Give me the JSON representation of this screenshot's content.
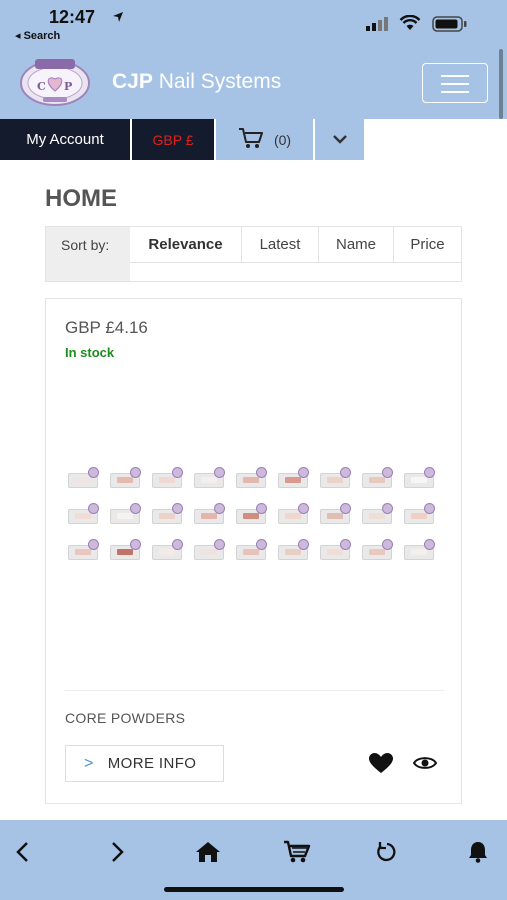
{
  "status_bar": {
    "time": "12:47",
    "back_label": "◂ Search"
  },
  "header": {
    "logo_text": "CJP",
    "brand_bold": "CJP",
    "brand_rest": " Nail Systems"
  },
  "account_bar": {
    "my_account": "My Account",
    "currency": "GBP £",
    "cart_count": "(0)"
  },
  "page": {
    "title": "HOME",
    "sort": {
      "label": "Sort by:",
      "options": [
        "Relevance",
        "Latest",
        "Name",
        "Price"
      ],
      "selected": "Relevance"
    }
  },
  "product": {
    "price": "GBP £4.16",
    "stock": "In stock",
    "name": "CORE POWDERS",
    "more_info": "MORE INFO",
    "swatch_colors": [
      "#efe6e3",
      "#e6b8b0",
      "#f0d9d2",
      "#f4efed",
      "#e3b7ac",
      "#d89a8e",
      "#edd2c8",
      "#e7c9bd",
      "#f8f6f4",
      "#f1dcd6",
      "#f6f2f0",
      "#ecd3c9",
      "#e5b4aa",
      "#cf8e80",
      "#f0d6cd",
      "#e2bdb1",
      "#edded7",
      "#f2cfc4",
      "#eac6be",
      "#c07468",
      "#f3ebe8",
      "#f0e2dc",
      "#e8c2b8",
      "#ebcdc4",
      "#f1ddd5",
      "#e9c9bf",
      "#f5efec"
    ]
  },
  "colors": {
    "header_bg": "#a6c3e6",
    "dark_bar": "#141b2d",
    "currency_red": "#e02020",
    "stock_green": "#1e8c1e"
  },
  "toolbar_icons": [
    "back-arrow-icon",
    "forward-arrow-icon",
    "home-icon",
    "cart-icon",
    "reload-icon",
    "bell-icon"
  ]
}
